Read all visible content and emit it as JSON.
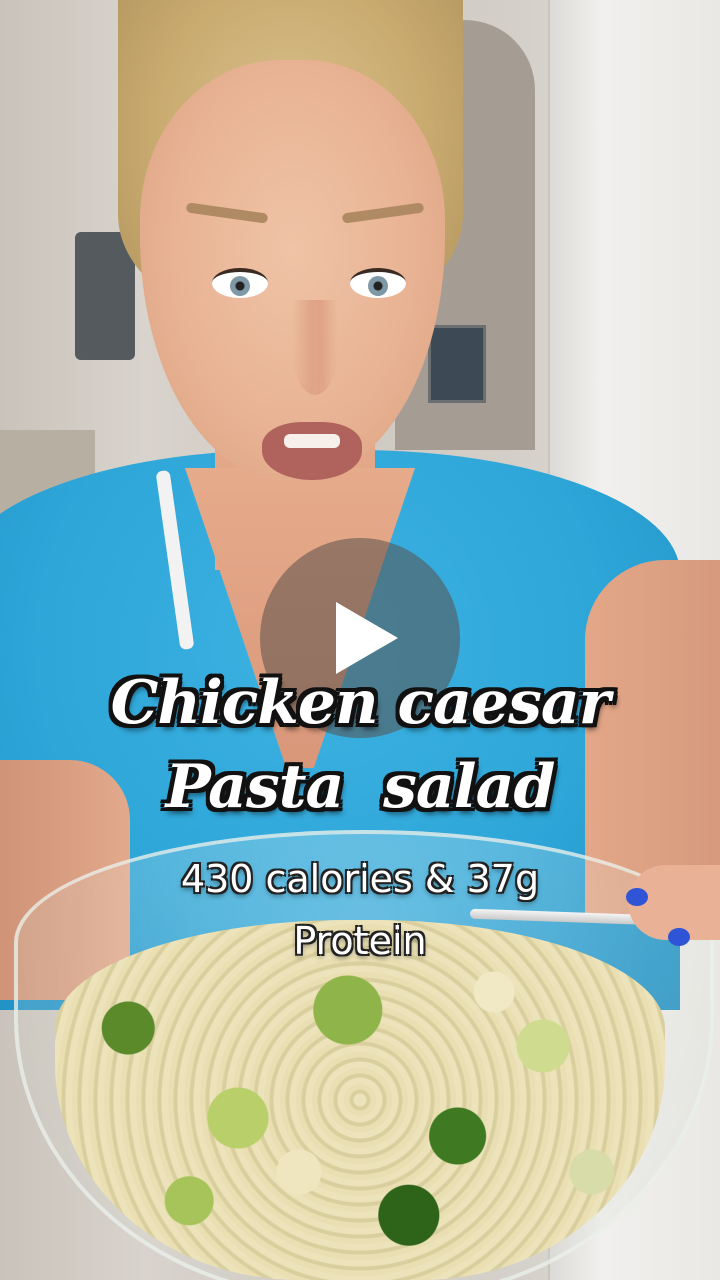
{
  "video": {
    "overlay_title_line1": "Chicken caesar",
    "overlay_title_line2": "Pasta  salad",
    "overlay_caption_line1": "430 calories & 37g",
    "overlay_caption_line2": "Protein",
    "play_icon": "play-icon"
  },
  "colors": {
    "shirt": "#2ea6d8",
    "overlay_text": "#ffffff",
    "text_outline": "#111111",
    "play_button_bg": "rgba(90,80,75,0.55)"
  }
}
